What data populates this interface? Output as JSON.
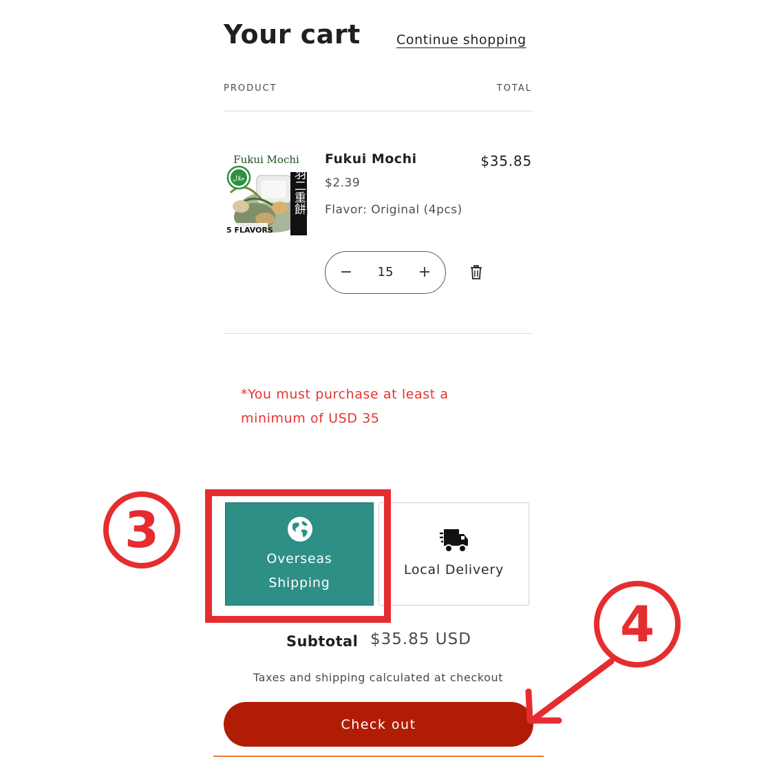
{
  "header": {
    "title": "Your cart",
    "continue_link": "Continue shopping"
  },
  "columns": {
    "product": "PRODUCT",
    "total": "TOTAL"
  },
  "item": {
    "image_label": "Fukui Mochi",
    "image_badge": "5 FLAVORS",
    "image_kanji": "羽二重餅",
    "image_halal": "حلال",
    "name": "Fukui Mochi",
    "unit_price": "$2.39",
    "variant": "Flavor: Original (4pcs)",
    "quantity": "15",
    "minus_symbol": "−",
    "plus_symbol": "+",
    "line_total": "$35.85"
  },
  "notice": "*You must purchase at least a minimum of USD 35",
  "shipping": {
    "options": [
      {
        "label_line1": "Overseas",
        "label_line2": "Shipping",
        "icon": "globe-icon",
        "selected": true,
        "bg": "#2e8f87"
      },
      {
        "label": "Local Delivery",
        "icon": "delivery-truck-icon",
        "selected": false
      }
    ]
  },
  "summary": {
    "subtotal_label": "Subtotal",
    "subtotal_value": "$35.85 USD",
    "tax_note": "Taxes and shipping calculated at checkout"
  },
  "checkout_label": "Check out",
  "annotations": {
    "step3": "3",
    "step4": "4",
    "color": "#e52d30"
  },
  "colors": {
    "checkout": "#b11c05",
    "notice": "#e8322f",
    "accent": "#2e8f87"
  }
}
